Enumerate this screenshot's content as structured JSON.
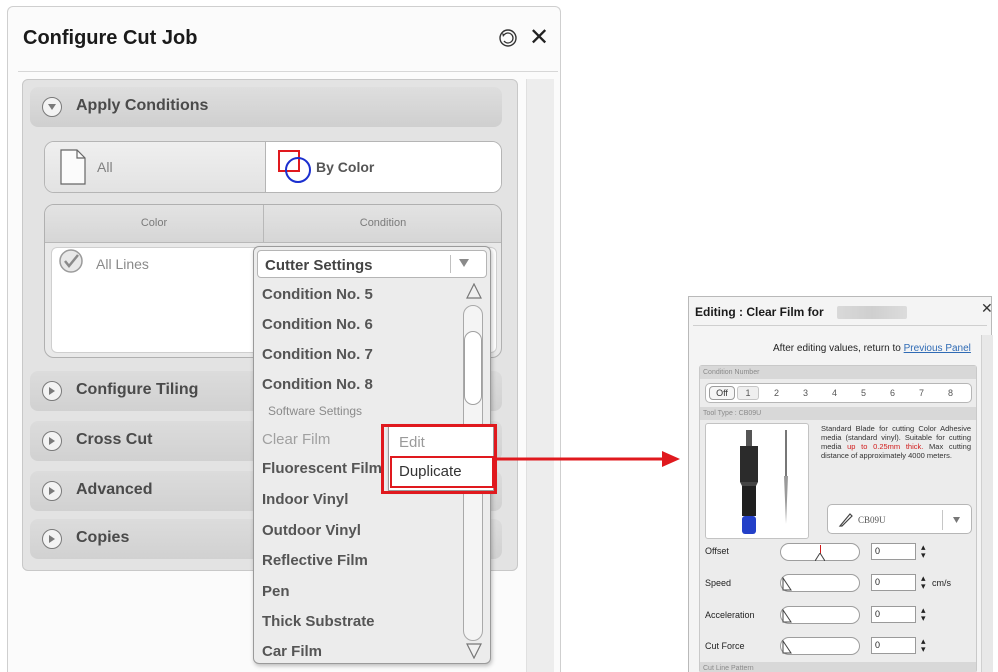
{
  "configure_panel": {
    "title": "Configure Cut Job",
    "sections": {
      "apply_conditions": "Apply Conditions",
      "configure_tiling": "Configure Tiling",
      "cross_cut": "Cross Cut",
      "advanced": "Advanced",
      "copies": "Copies"
    },
    "apply_mode": {
      "all_label": "All",
      "by_color_label": "By Color",
      "selected": "By Color"
    },
    "table": {
      "headers": [
        "Color",
        "Condition"
      ],
      "row": {
        "color": "All Lines"
      }
    },
    "condition_dropdown": {
      "selected": "Cutter Settings",
      "items": [
        "Condition No. 5",
        "Condition No. 6",
        "Condition No. 7",
        "Condition No. 8"
      ],
      "group_label": "Software Settings",
      "software_items": [
        "Clear Film",
        "Fluorescent Film",
        "Indoor Vinyl",
        "Outdoor Vinyl",
        "Reflective Film",
        "Pen",
        "Thick Substrate",
        "Car Film"
      ]
    },
    "context_menu": {
      "edit": "Edit",
      "duplicate": "Duplicate"
    }
  },
  "editing_dialog": {
    "title": "Editing : Clear Film for",
    "note_prefix": "After editing values, return to",
    "note_link": "Previous Panel",
    "condition_number_label": "Condition Number",
    "condition_numbers": [
      "Off",
      "1",
      "2",
      "3",
      "4",
      "5",
      "6",
      "7",
      "8"
    ],
    "tool_type_label": "Tool Type : CB09U",
    "tool_description": "Standard Blade for cutting Color Adhesive media (standard vinyl). Suitable for cutting media",
    "tool_description_highlight": "up to 0.25mm thick.",
    "tool_description_end": "Max cutting distance of approximately 4000 meters.",
    "tool_selected": "CB09U",
    "parameters": [
      {
        "label": "Offset",
        "value": "0",
        "unit": ""
      },
      {
        "label": "Speed",
        "value": "0",
        "unit": "cm/s"
      },
      {
        "label": "Acceleration",
        "value": "0",
        "unit": ""
      },
      {
        "label": "Cut Force",
        "value": "0",
        "unit": ""
      }
    ],
    "cut_line_pattern_label": "Cut Line Pattern"
  },
  "colors": {
    "highlight_red": "#e0191e",
    "link_blue": "#2f6bb5",
    "warning_red": "#d11b1b"
  }
}
